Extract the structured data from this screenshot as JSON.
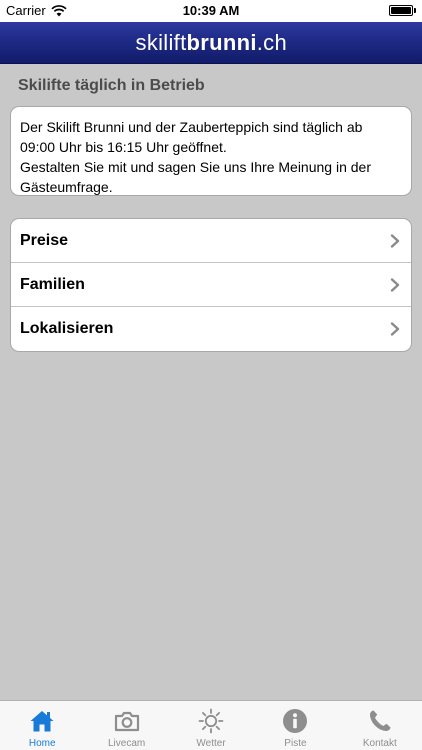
{
  "status_bar": {
    "carrier": "Carrier",
    "time": "10:39 AM",
    "battery_percent": 100
  },
  "nav": {
    "brand_light": "skilift",
    "brand_bold": "brunni",
    "brand_suffix": ".ch"
  },
  "section_title": "Skilifte täglich in Betrieb",
  "info": {
    "line1": "Der Skilift Brunni und der Zauberteppich sind täglich ab",
    "line2": "09:00 Uhr bis 16:15 Uhr geöffnet.",
    "line3": "Gestalten Sie mit und sagen Sie uns Ihre Meinung in der",
    "line4": "Gästeumfrage."
  },
  "menu": {
    "items": [
      {
        "label": "Preise"
      },
      {
        "label": "Familien"
      },
      {
        "label": "Lokalisieren"
      }
    ]
  },
  "tabs": {
    "items": [
      {
        "label": "Home",
        "icon": "home-icon"
      },
      {
        "label": "Livecam",
        "icon": "camera-icon"
      },
      {
        "label": "Wetter",
        "icon": "sun-icon"
      },
      {
        "label": "Piste",
        "icon": "info-icon"
      },
      {
        "label": "Kontakt",
        "icon": "phone-icon"
      }
    ],
    "active_index": 0,
    "active_color": "#1a7ad9",
    "inactive_color": "#8e8e8e"
  },
  "colors": {
    "nav_bar": "#1e2a86",
    "background": "#c8c8c8"
  }
}
